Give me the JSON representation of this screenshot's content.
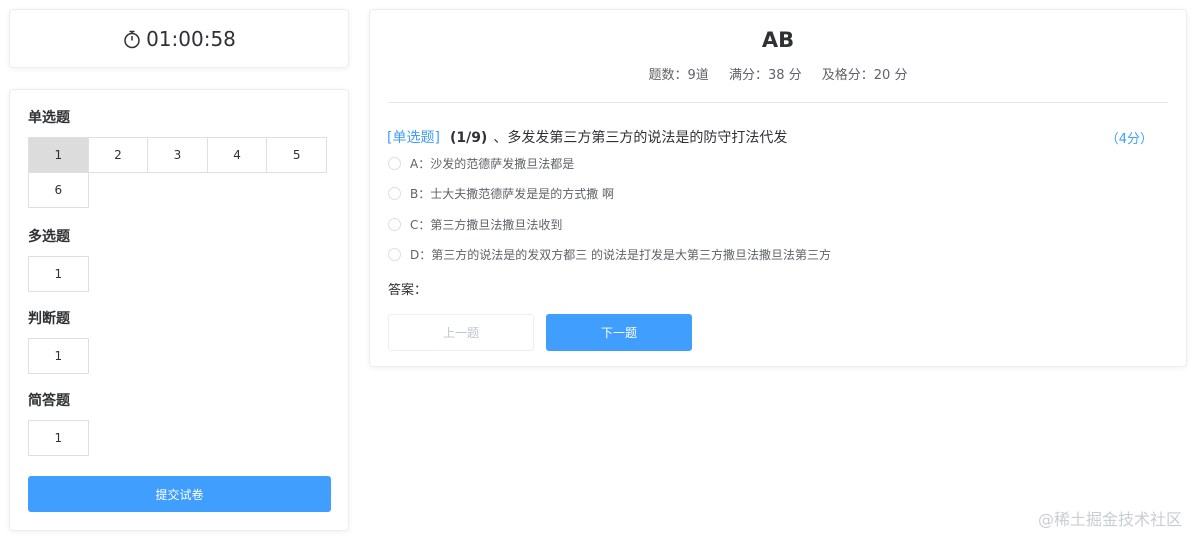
{
  "timer": {
    "value": "01:00:58",
    "icon": "stopwatch-icon"
  },
  "nav": {
    "sections": [
      {
        "title": "单选题",
        "items": [
          "1",
          "2",
          "3",
          "4",
          "5",
          "6"
        ],
        "active_index": 0
      },
      {
        "title": "多选题",
        "items": [
          "1"
        ]
      },
      {
        "title": "判断题",
        "items": [
          "1"
        ]
      },
      {
        "title": "简答题",
        "items": [
          "1"
        ]
      }
    ],
    "submit_label": "提交试卷"
  },
  "exam": {
    "title": "AB",
    "count": "题数：9道",
    "full_score": "满分：38 分",
    "pass_score": "及格分：20 分"
  },
  "question": {
    "type_label": "[单选题]",
    "number": "(1/9)",
    "text": "、多发发第三方第三方的说法是的防守打法代发",
    "score": "（4分）",
    "options": [
      "A：沙发的范德萨发撒旦法都是",
      "B：士大夫撒范德萨发是是的方式撒 啊",
      "C：第三方撒旦法撒旦法收到",
      "D：第三方的说法是的发双方都三 的说法是打发是大第三方撒旦法撒旦法第三方"
    ],
    "answer_label": "答案："
  },
  "buttons": {
    "prev": "上一题",
    "next": "下一题"
  },
  "watermark": "@稀土掘金技术社区",
  "colors": {
    "accent": "#409eff",
    "active_cell": "#dcdcdc"
  }
}
